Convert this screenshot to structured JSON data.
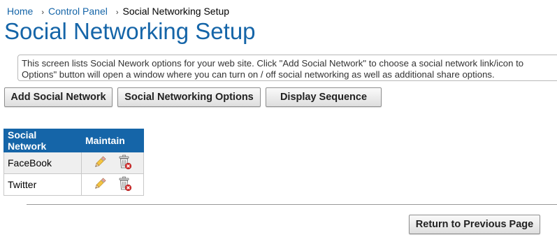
{
  "breadcrumb": {
    "home": "Home",
    "control_panel": "Control Panel",
    "current": "Social Networking Setup",
    "separator": "›"
  },
  "page_title": "Social Networking Setup",
  "info_text_line1": "This screen lists Social Nework options for your web site. Click \"Add Social Network\" to choose a social network link/icon to",
  "info_text_line2": "Options\" button will open a window where you can turn on / off social networking as well as additional share options.",
  "buttons": {
    "add": "Add Social Network",
    "options": "Social Networking Options",
    "sequence": "Display Sequence",
    "return": "Return to Previous Page"
  },
  "table": {
    "headers": [
      "Social Network",
      "Maintain"
    ],
    "rows": [
      {
        "name": "FaceBook"
      },
      {
        "name": "Twitter"
      }
    ]
  },
  "icons": {
    "edit": "pencil-icon",
    "delete": "trash-delete-icon"
  },
  "colors": {
    "accent": "#1565a8",
    "header_bg": "#1565a8",
    "delete_mark": "#d62b2b"
  }
}
